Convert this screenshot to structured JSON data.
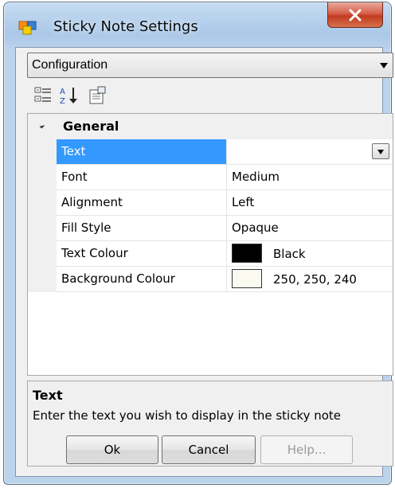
{
  "window": {
    "title": "Sticky Note Settings",
    "close_label": "x"
  },
  "object_selector": {
    "selected": "Configuration"
  },
  "toolbar": {
    "icons": [
      "categorized-icon",
      "alphabetical-sort-icon",
      "property-pages-icon"
    ]
  },
  "property_grid": {
    "category": "General",
    "rows": [
      {
        "name": "Text",
        "value": "",
        "selected": true
      },
      {
        "name": "Font",
        "value": "Medium"
      },
      {
        "name": "Alignment",
        "value": "Left"
      },
      {
        "name": "Fill Style",
        "value": "Opaque"
      },
      {
        "name": "Text Colour",
        "value": "Black",
        "swatch": "#000000"
      },
      {
        "name": "Background Colour",
        "value": "250, 250, 240",
        "swatch": "#fafaf0"
      }
    ]
  },
  "description": {
    "title": "Text",
    "text": "Enter the text you wish to display in the sticky note"
  },
  "buttons": {
    "ok": "Ok",
    "cancel": "Cancel",
    "help": "Help..."
  },
  "colors": {
    "selection": "#3399ff",
    "close_button": "#c7442b"
  }
}
